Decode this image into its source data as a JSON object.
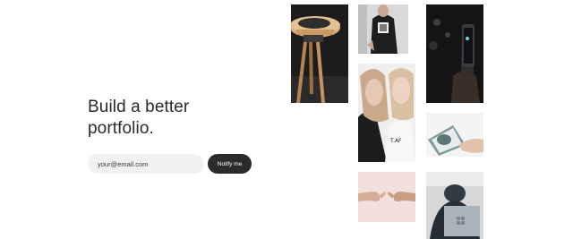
{
  "hero": {
    "headline_line1": "Build a better",
    "headline_line2": "portfolio."
  },
  "signup": {
    "email_placeholder": "your@email.com",
    "notify_label": "Notify me"
  },
  "gallery": {
    "photos": [
      {
        "subject": "wooden-stool"
      },
      {
        "subject": "person-in-printed-hoodie"
      },
      {
        "subject": "two-women-portrait"
      },
      {
        "subject": "phone-in-hand-at-night"
      },
      {
        "subject": "hand-holding-book"
      },
      {
        "subject": "hands-pinky-promise"
      },
      {
        "subject": "person-with-laptop"
      }
    ]
  },
  "colors": {
    "background": "#ffffff",
    "text": "#2a2a2a",
    "input_bg": "#f1f1f1",
    "button_bg": "#2b2b2b",
    "button_text": "#ffffff"
  }
}
